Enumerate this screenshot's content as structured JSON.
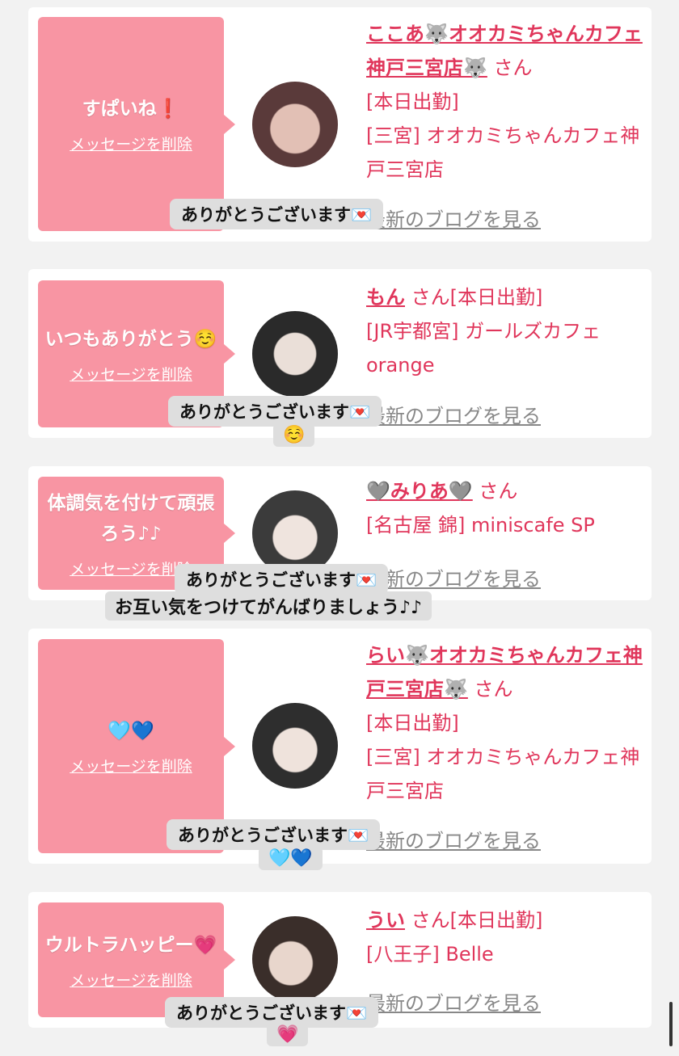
{
  "delete_label": "メッセージを削除",
  "blog_label": "最新のブログを見る",
  "san_label": "さん",
  "cards": [
    {
      "message": "すぱいね❗️",
      "name": "ここあ🐺オオカミちゃんカフェ神戸三宮店🐺",
      "status": "[本日出勤]",
      "area": "[三宮] オオカミちゃんカフェ神戸三宮店",
      "reply": "ありがとうございます💌",
      "reply_extra": "",
      "avatar_colors": [
        "#5a3a3a",
        "#d9b3a6"
      ]
    },
    {
      "message": "いつもありがとう☺️",
      "name": "もん",
      "status": "[本日出勤]",
      "area": "[JR宇都宮] ガールズカフェorange",
      "reply": "ありがとうございます💌",
      "reply_extra": "☺️",
      "avatar_colors": [
        "#2a2a2a",
        "#e9dcd6"
      ]
    },
    {
      "message": "体調気を付けて頑張ろう♪♪",
      "name": "🩶みりあ🩶",
      "status": "",
      "area": "[名古屋 錦] miniscafe SP",
      "reply": "ありがとうございます💌",
      "reply_extra": "お互い気をつけてがんばりましょう♪♪",
      "avatar_colors": [
        "#3b3b3b",
        "#f0e6e0"
      ]
    },
    {
      "message": "🩵💙",
      "name": "らい🐺オオカミちゃんカフェ神戸三宮店🐺",
      "status": "[本日出勤]",
      "area": "[三宮] オオカミちゃんカフェ神戸三宮店",
      "reply": "ありがとうございます💌",
      "reply_extra": "🩵💙",
      "avatar_colors": [
        "#2e2e2e",
        "#eee3dc"
      ]
    },
    {
      "message": "ウルトラハッピー💗",
      "name": "うい",
      "status": "[本日出勤]",
      "area": "[八王子] Belle",
      "reply": "ありがとうございます💌",
      "reply_extra": "💗",
      "avatar_colors": [
        "#3a2e2a",
        "#e8d6cc"
      ]
    }
  ]
}
